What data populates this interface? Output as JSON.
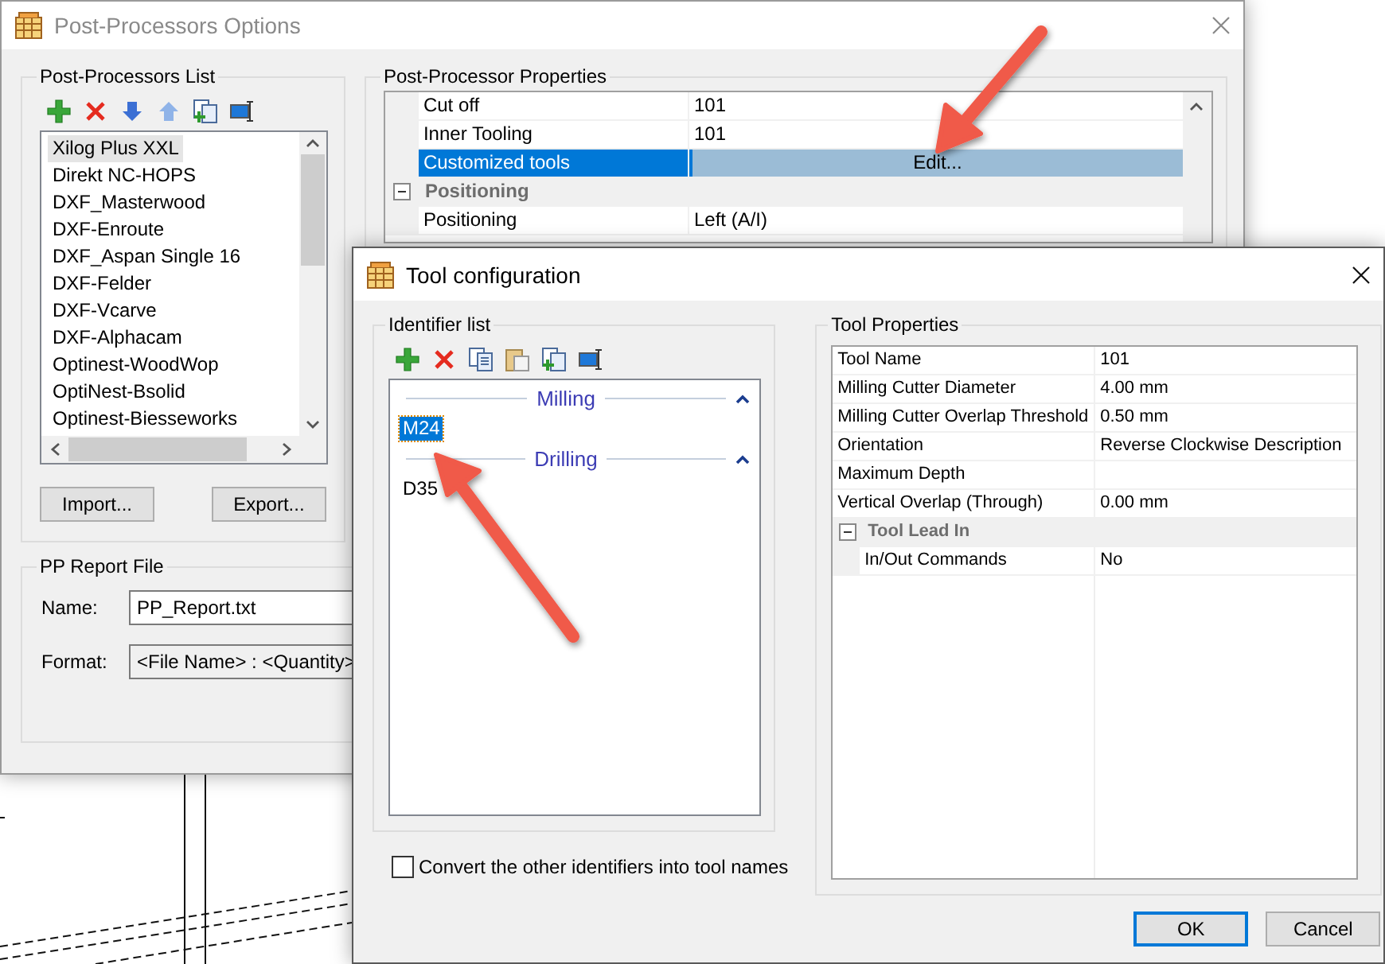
{
  "main_window": {
    "title": "Post-Processors Options",
    "pp_list": {
      "title": "Post-Processors List",
      "items": [
        {
          "label": "Xilog Plus XXL",
          "selected": true
        },
        {
          "label": "Direkt NC-HOPS",
          "selected": false
        },
        {
          "label": "DXF_Masterwood",
          "selected": false
        },
        {
          "label": "DXF-Enroute",
          "selected": false
        },
        {
          "label": "DXF_Aspan Single 16",
          "selected": false
        },
        {
          "label": "DXF-Felder",
          "selected": false
        },
        {
          "label": "DXF-Vcarve",
          "selected": false
        },
        {
          "label": "DXF-Alphacam",
          "selected": false
        },
        {
          "label": "Optinest-WoodWop",
          "selected": false
        },
        {
          "label": "OptiNest-Bsolid",
          "selected": false
        },
        {
          "label": "Optinest-Biesseworks",
          "selected": false
        }
      ],
      "buttons": [
        "Import...",
        "Export..."
      ]
    },
    "properties": {
      "title": "Post-Processor Properties",
      "rows": [
        {
          "kind": "property",
          "name": "Cut off",
          "value": "101",
          "selected": false
        },
        {
          "kind": "property",
          "name": "Inner Tooling",
          "value": "101",
          "selected": false
        },
        {
          "kind": "button",
          "name": "Customized tools",
          "value": "Edit...",
          "selected": true
        },
        {
          "kind": "category",
          "name": "Positioning",
          "expanded": true,
          "children": [
            {
              "kind": "property",
              "name": "Positioning",
              "value": "Left (A/I)",
              "selected": false
            }
          ]
        }
      ]
    },
    "report": {
      "title": "PP Report File",
      "fields": [
        {
          "label": "Name:",
          "value": "PP_Report.txt"
        },
        {
          "label": "Format:",
          "value": "<File Name> : <Quantity>"
        }
      ]
    }
  },
  "dialog": {
    "title": "Tool configuration",
    "identifiers": {
      "title": "Identifier list",
      "groups": [
        {
          "name": "Milling",
          "expanded": true,
          "items": [
            {
              "label": "M24",
              "selected": true
            }
          ]
        },
        {
          "name": "Drilling",
          "expanded": true,
          "items": [
            {
              "label": "D35",
              "selected": false
            }
          ]
        }
      ]
    },
    "convert": {
      "label": "Convert the other identifiers into tool names",
      "checked": false
    },
    "tool_properties": {
      "title": "Tool Properties",
      "rows": [
        {
          "kind": "property",
          "name": "Tool Name",
          "value": "101",
          "selected": false
        },
        {
          "kind": "property",
          "name": "Milling Cutter Diameter",
          "value": "4.00 mm",
          "selected": false
        },
        {
          "kind": "property",
          "name": "Milling Cutter Overlap Threshold",
          "value": "0.50 mm",
          "selected": false
        },
        {
          "kind": "property",
          "name": "Orientation",
          "value": "Reverse Clockwise Description",
          "selected": false
        },
        {
          "kind": "property",
          "name": "Maximum Depth",
          "selected": false
        },
        {
          "kind": "property",
          "name": "Vertical Overlap (Through)",
          "value": "0.00 mm",
          "selected": false
        },
        {
          "kind": "category",
          "name": "Tool Lead In",
          "expanded": true,
          "children": [
            {
              "kind": "property",
              "name": "In/Out Commands",
              "value": "No",
              "selected": false
            }
          ]
        }
      ]
    },
    "buttons": [
      {
        "label": "OK",
        "default": true
      },
      {
        "label": "Cancel",
        "default": false
      }
    ]
  }
}
